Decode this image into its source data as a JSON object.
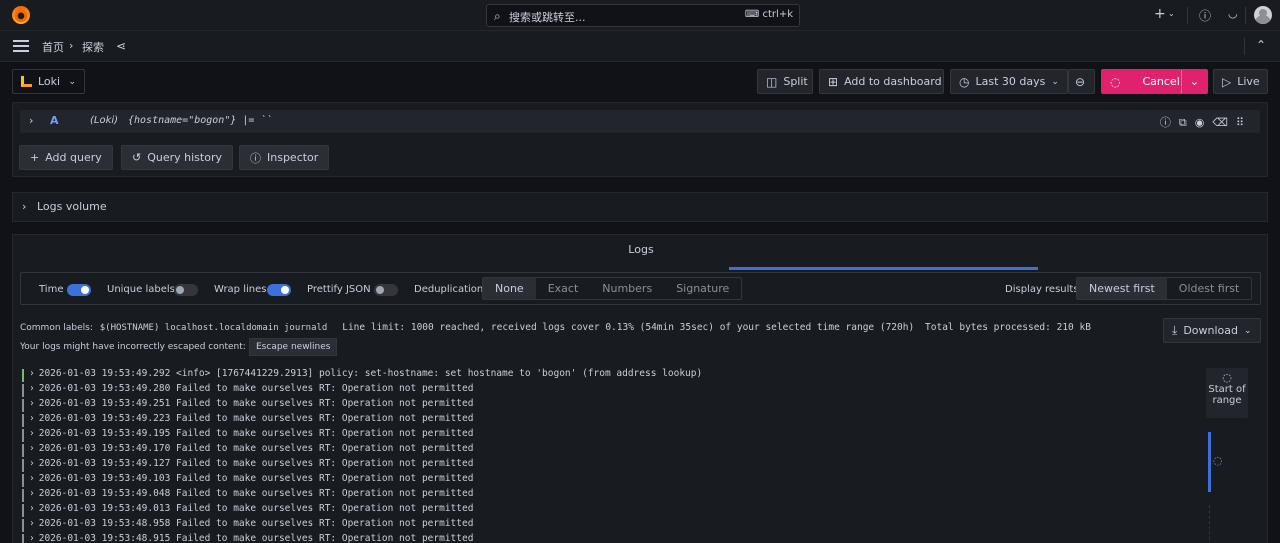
{
  "topbar": {
    "search_placeholder": "搜索或跳转至...",
    "search_shortcut": "ctrl+k",
    "icons": [
      "grafana-logo-icon",
      "search-icon",
      "plus-icon",
      "help-icon",
      "rss-icon",
      "avatar"
    ]
  },
  "breadcrumb": {
    "home": "首页",
    "separator": "›",
    "current": "探索"
  },
  "toolbar": {
    "datasource": "Loki",
    "split": "Split",
    "add_to_dashboard": "Add to dashboard",
    "time_range": "Last 30 days",
    "cancel": "Cancel",
    "live": "Live"
  },
  "query": {
    "ref_id": "A",
    "datasource": "(Loki)",
    "expr": "{hostname=\"bogon\"} |= ``",
    "add_query": "Add query",
    "query_history": "Query history",
    "inspector": "Inspector"
  },
  "logs_volume": {
    "title": "Logs volume"
  },
  "logs": {
    "title": "Logs",
    "options": {
      "time": "Time",
      "time_on": true,
      "unique_labels": "Unique labels",
      "unique_labels_on": false,
      "wrap_lines": "Wrap lines",
      "wrap_lines_on": true,
      "prettify_json": "Prettify JSON",
      "prettify_json_on": false,
      "deduplication": "Deduplication",
      "dedup_options": [
        "None",
        "Exact",
        "Numbers",
        "Signature"
      ],
      "dedup_selected": "None",
      "display_results": "Display results",
      "order_options": [
        "Newest first",
        "Oldest first"
      ],
      "order_selected": "Newest first"
    },
    "common_labels_label": "Common labels:",
    "common_labels": "$(HOSTNAME) localhost.localdomain journald",
    "line_limit": "Line limit: 1000 reached, received logs cover 0.13% (54min 35sec) of your selected time range (720h)",
    "bytes_processed": "Total bytes processed: 210 kB",
    "escape_warning": "Your logs might have incorrectly escaped content:",
    "escape_button": "Escape newlines",
    "download": "Download",
    "nav_start": "Start of range",
    "lines": [
      {
        "prefix": "›",
        "text": "2026-01-03 19:53:49.292 <info>  [1767441229.2913] policy: set-hostname: set hostname to 'bogon' (from address lookup)",
        "level": "info"
      },
      {
        "prefix": "›",
        "text": "2026-01-03 19:53:49.280 Failed to make ourselves RT: Operation not permitted",
        "level": "unknown"
      },
      {
        "prefix": "›",
        "text": "2026-01-03 19:53:49.251 Failed to make ourselves RT: Operation not permitted",
        "level": "unknown"
      },
      {
        "prefix": "›",
        "text": "2026-01-03 19:53:49.223 Failed to make ourselves RT: Operation not permitted",
        "level": "unknown"
      },
      {
        "prefix": "›",
        "text": "2026-01-03 19:53:49.195 Failed to make ourselves RT: Operation not permitted",
        "level": "unknown"
      },
      {
        "prefix": "›",
        "text": "2026-01-03 19:53:49.170 Failed to make ourselves RT: Operation not permitted",
        "level": "unknown"
      },
      {
        "prefix": "›",
        "text": "2026-01-03 19:53:49.127 Failed to make ourselves RT: Operation not permitted",
        "level": "unknown"
      },
      {
        "prefix": "›",
        "text": "2026-01-03 19:53:49.103 Failed to make ourselves RT: Operation not permitted",
        "level": "unknown"
      },
      {
        "prefix": "›",
        "text": "2026-01-03 19:53:49.048 Failed to make ourselves RT: Operation not permitted",
        "level": "unknown"
      },
      {
        "prefix": "›",
        "text": "2026-01-03 19:53:49.013 Failed to make ourselves RT: Operation not permitted",
        "level": "unknown"
      },
      {
        "prefix": "›",
        "text": "2026-01-03 19:53:48.958 Failed to make ourselves RT: Operation not permitted",
        "level": "unknown"
      },
      {
        "prefix": "›",
        "text": "2026-01-03 19:53:48.915 Failed to make ourselves RT: Operation not permitted",
        "level": "unknown"
      }
    ]
  },
  "colors": {
    "accent": "#3d71d9",
    "cancel": "#e0226e",
    "info_level": "#73bf69",
    "background": "#111217",
    "panel": "#181b1f"
  }
}
